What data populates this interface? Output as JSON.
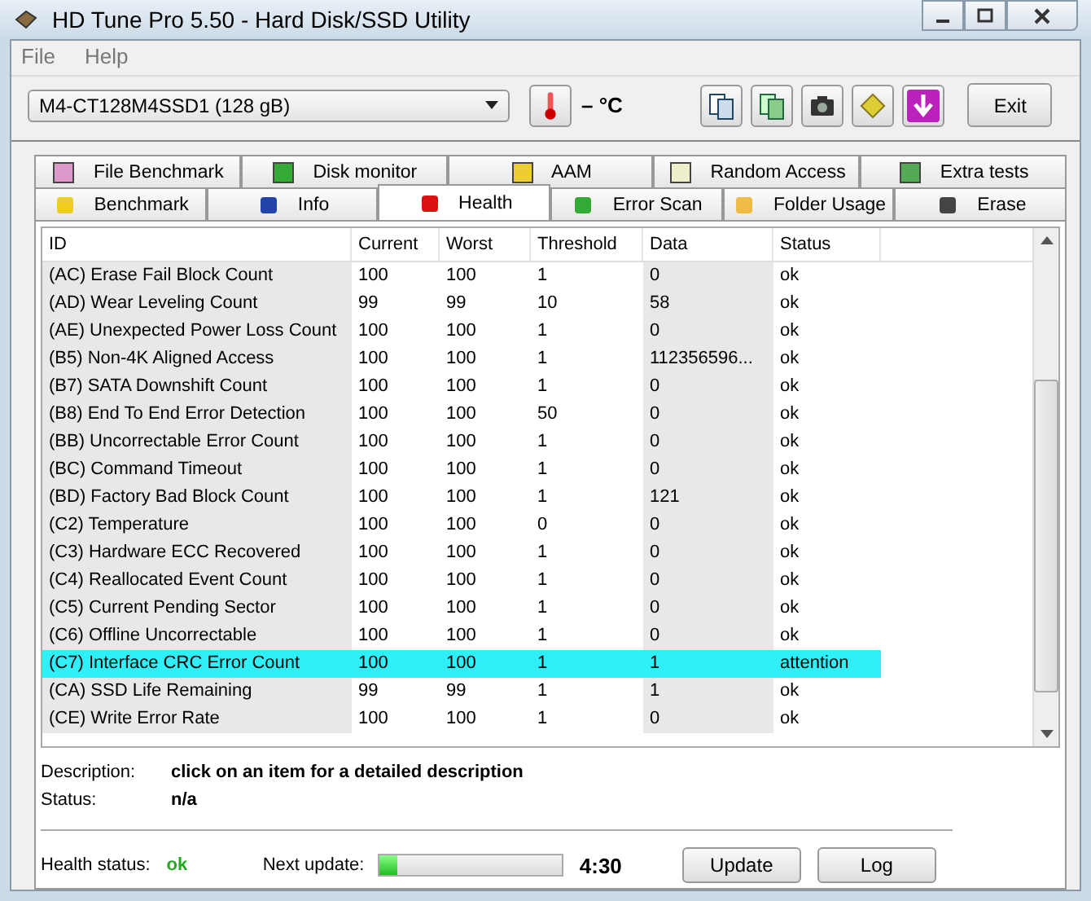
{
  "window": {
    "title": "HD Tune Pro 5.50 - Hard Disk/SSD Utility"
  },
  "menu": [
    "File",
    "Help"
  ],
  "drive": {
    "value": "M4-CT128M4SSD1 (128 gB)"
  },
  "temperature": "– °C",
  "exit_button": "Exit",
  "tabs_top": [
    {
      "label": "File Benchmark",
      "selected": false
    },
    {
      "label": "Disk monitor",
      "selected": false
    },
    {
      "label": "AAM",
      "selected": false
    },
    {
      "label": "Random Access",
      "selected": false
    },
    {
      "label": "Extra tests",
      "selected": false
    }
  ],
  "tabs_bottom": [
    {
      "label": "Benchmark",
      "selected": false
    },
    {
      "label": "Info",
      "selected": false
    },
    {
      "label": "Health",
      "selected": true
    },
    {
      "label": "Error Scan",
      "selected": false
    },
    {
      "label": "Folder Usage",
      "selected": false
    },
    {
      "label": "Erase",
      "selected": false
    }
  ],
  "table": {
    "columns": [
      "ID",
      "Current",
      "Worst",
      "Threshold",
      "Data",
      "Status"
    ],
    "rows": [
      {
        "cells": [
          "(AC) Erase Fail Block Count",
          "100",
          "100",
          "1",
          "0",
          "ok"
        ],
        "selected": false
      },
      {
        "cells": [
          "(AD) Wear Leveling Count",
          "99",
          "99",
          "10",
          "58",
          "ok"
        ],
        "selected": false
      },
      {
        "cells": [
          "(AE) Unexpected Power Loss Count",
          "100",
          "100",
          "1",
          "0",
          "ok"
        ],
        "selected": false
      },
      {
        "cells": [
          "(B5) Non-4K Aligned Access",
          "100",
          "100",
          "1",
          "112356596...",
          "ok"
        ],
        "selected": false
      },
      {
        "cells": [
          "(B7) SATA Downshift Count",
          "100",
          "100",
          "1",
          "0",
          "ok"
        ],
        "selected": false
      },
      {
        "cells": [
          "(B8) End To End Error Detection",
          "100",
          "100",
          "50",
          "0",
          "ok"
        ],
        "selected": false
      },
      {
        "cells": [
          "(BB) Uncorrectable Error Count",
          "100",
          "100",
          "1",
          "0",
          "ok"
        ],
        "selected": false
      },
      {
        "cells": [
          "(BC) Command Timeout",
          "100",
          "100",
          "1",
          "0",
          "ok"
        ],
        "selected": false
      },
      {
        "cells": [
          "(BD) Factory Bad Block Count",
          "100",
          "100",
          "1",
          "121",
          "ok"
        ],
        "selected": false
      },
      {
        "cells": [
          "(C2) Temperature",
          "100",
          "100",
          "0",
          "0",
          "ok"
        ],
        "selected": false
      },
      {
        "cells": [
          "(C3) Hardware ECC Recovered",
          "100",
          "100",
          "1",
          "0",
          "ok"
        ],
        "selected": false
      },
      {
        "cells": [
          "(C4) Reallocated Event Count",
          "100",
          "100",
          "1",
          "0",
          "ok"
        ],
        "selected": false
      },
      {
        "cells": [
          "(C5) Current Pending Sector",
          "100",
          "100",
          "1",
          "0",
          "ok"
        ],
        "selected": false
      },
      {
        "cells": [
          "(C6) Offline Uncorrectable",
          "100",
          "100",
          "1",
          "0",
          "ok"
        ],
        "selected": false
      },
      {
        "cells": [
          "(C7) Interface CRC Error Count",
          "100",
          "100",
          "1",
          "1",
          "attention"
        ],
        "selected": true
      },
      {
        "cells": [
          "(CA) SSD Life Remaining",
          "99",
          "99",
          "1",
          "1",
          "ok"
        ],
        "selected": false
      },
      {
        "cells": [
          "(CE) Write Error Rate",
          "100",
          "100",
          "1",
          "0",
          "ok"
        ],
        "selected": false
      }
    ]
  },
  "description": {
    "label": "Description:",
    "value": "click on an item for a detailed description"
  },
  "status": {
    "label": "Status:",
    "value": "n/a"
  },
  "health_status": {
    "label": "Health status:",
    "value": "ok"
  },
  "next_update": {
    "label": "Next update:",
    "level": 0.1,
    "time": "4:30"
  },
  "buttons": [
    "Update",
    "Log"
  ]
}
